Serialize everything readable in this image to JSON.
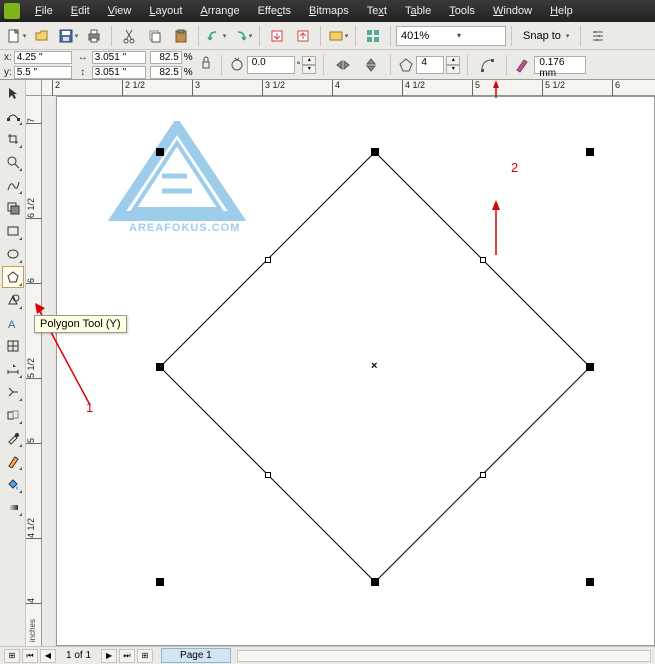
{
  "menu": {
    "items": [
      "File",
      "Edit",
      "View",
      "Layout",
      "Arrange",
      "Effects",
      "Bitmaps",
      "Text",
      "Table",
      "Tools",
      "Window",
      "Help"
    ]
  },
  "toolbar": {
    "zoom": "401%",
    "snap_label": "Snap to"
  },
  "props": {
    "x": "4.25 \"",
    "y": "5.5 \"",
    "w": "3.051 \"",
    "h": "3.051 \"",
    "sx": "82.5",
    "sy": "82.5",
    "rotation": "0.0",
    "sides": "4",
    "outline": "0.176 mm"
  },
  "ruler": {
    "h_labels": [
      "2",
      "2 1/2",
      "3",
      "3 1/2",
      "4",
      "4 1/2",
      "5",
      "5 1/2",
      "6"
    ],
    "v_labels": [
      "7",
      "6 1/2",
      "6",
      "5 1/2",
      "5",
      "4 1/2",
      "4"
    ],
    "units": "inches"
  },
  "tooltip": "Polygon Tool (Y)",
  "annotations": {
    "one": "1",
    "two": "2"
  },
  "logo_text": "AREAFOKUS.COM",
  "status": {
    "page_count": "1 of 1",
    "page_tab": "Page 1"
  }
}
